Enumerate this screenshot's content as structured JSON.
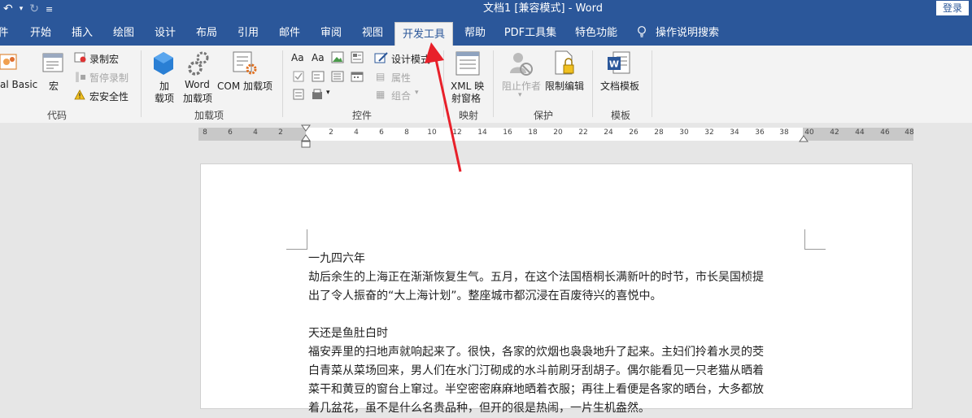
{
  "titlebar": {
    "doc_title": "文档1 [兼容模式]  -  Word",
    "login_label": "登录"
  },
  "tabs": [
    {
      "label": "件",
      "active": false
    },
    {
      "label": "开始",
      "active": false
    },
    {
      "label": "插入",
      "active": false
    },
    {
      "label": "绘图",
      "active": false
    },
    {
      "label": "设计",
      "active": false
    },
    {
      "label": "布局",
      "active": false
    },
    {
      "label": "引用",
      "active": false
    },
    {
      "label": "邮件",
      "active": false
    },
    {
      "label": "审阅",
      "active": false
    },
    {
      "label": "视图",
      "active": false
    },
    {
      "label": "开发工具",
      "active": true
    },
    {
      "label": "帮助",
      "active": false
    },
    {
      "label": "PDF工具集",
      "active": false
    },
    {
      "label": "特色功能",
      "active": false
    }
  ],
  "tell_me": "操作说明搜索",
  "ribbon": {
    "code": {
      "label": "代码",
      "visual_basic": "al Basic",
      "macros": "宏",
      "record_macro": "录制宏",
      "pause_recording": "暂停录制",
      "macro_security": "宏安全性"
    },
    "addins": {
      "label": "加载项",
      "addins_line1": "加",
      "addins_line2": "载项",
      "word_addins_line1": "Word",
      "word_addins_line2": "加载项",
      "com_addins": "COM 加载项"
    },
    "controls": {
      "label": "控件",
      "design_mode": "设计模式",
      "properties": "属性",
      "group": "组合"
    },
    "mapping": {
      "label": "映射",
      "xml_line1": "XML 映",
      "xml_line2": "射窗格"
    },
    "protect": {
      "label": "保护",
      "block_authors": "阻止作者",
      "restrict_editing": "限制编辑"
    },
    "templates": {
      "label": "模板",
      "document_template": "文档模板"
    }
  },
  "ruler": [
    "8",
    "6",
    "4",
    "2",
    "2",
    "4",
    "6",
    "8",
    "10",
    "12",
    "14",
    "16",
    "18",
    "20",
    "22",
    "24",
    "26",
    "28",
    "30",
    "32",
    "34",
    "36",
    "38",
    "40",
    "42",
    "44",
    "46",
    "48"
  ],
  "document": {
    "lines": [
      "一九四六年",
      "劫后余生的上海正在渐渐恢复生气。五月，在这个法国梧桐长满新叶的时节，市长吴国桢提",
      "出了令人振奋的“大上海计划”。整座城市都沉浸在百废待兴的喜悦中。",
      "",
      "天还是鱼肚白时",
      "福安弄里的扫地声就响起来了。很快，各家的炊烟也袅袅地升了起来。主妇们拎着水灵的茭",
      "白青菜从菜场回来，男人们在水门汀砌成的水斗前刷牙刮胡子。偶尔能看见一只老猫从晒着",
      "菜干和黄豆的窗台上窜过。半空密密麻麻地晒着衣服；再往上看便是各家的晒台，大多都放",
      "着几盆花，虽不是什么名贵品种，但开的很是热闹，一片生机盎然。"
    ]
  }
}
